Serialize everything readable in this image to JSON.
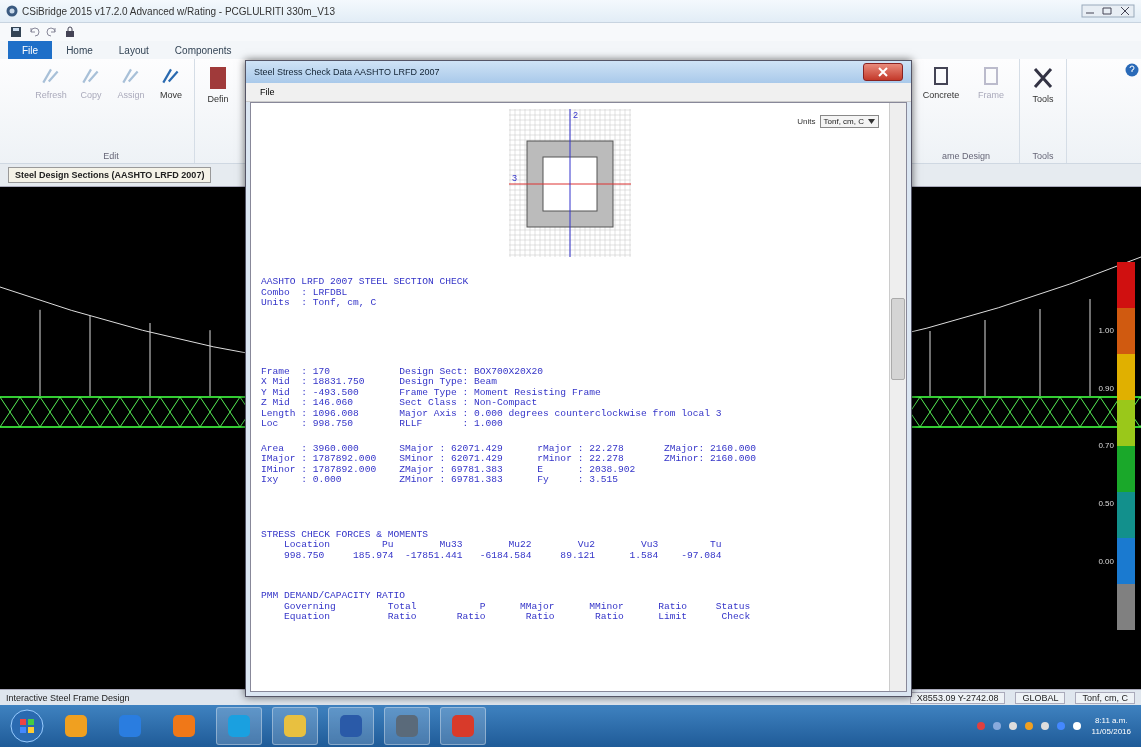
{
  "window": {
    "title": "CSiBridge 2015 v17.2.0 Advanced w/Rating  - PCGLULRITI 330m_V13"
  },
  "ribbon_tabs": [
    {
      "label": "File",
      "kind": "file"
    },
    {
      "label": "Home",
      "kind": "tab"
    },
    {
      "label": "Layout",
      "kind": "tab"
    },
    {
      "label": "Components",
      "kind": "tab"
    }
  ],
  "ribbon_left": {
    "buttons": [
      {
        "label": "Refresh",
        "disabled": true
      },
      {
        "label": "Copy",
        "disabled": true
      },
      {
        "label": "Assign",
        "disabled": true
      },
      {
        "label": "Move",
        "disabled": false
      }
    ],
    "group": "Edit",
    "cut_button": "Defin"
  },
  "ribbon_right": {
    "buttons": [
      {
        "label": "Concrete",
        "disabled": false
      },
      {
        "label": "Frame",
        "disabled": true
      }
    ],
    "group": "ame Design",
    "tools_button": "Tools",
    "tools_group": "Tools"
  },
  "panel_title": "Steel Design Sections (AASHTO LRFD 2007)",
  "legend": {
    "segments": [
      {
        "color": "#d01010"
      },
      {
        "color": "#d05a10"
      },
      {
        "color": "#e0b000"
      },
      {
        "color": "#9ac81a"
      },
      {
        "color": "#1aa82a"
      },
      {
        "color": "#12908c"
      },
      {
        "color": "#1a7ad0"
      },
      {
        "color": "#808080"
      }
    ],
    "labels": [
      "1.00",
      "0.90",
      "0.70",
      "0.50",
      "0.00"
    ]
  },
  "dialog": {
    "title": "Steel Stress Check Data  AASHTO LRFD 2007",
    "menu": [
      "File"
    ],
    "units_label": "Units",
    "units_value": "Tonf, cm, C",
    "section_axes": [
      "2",
      "3"
    ],
    "report": [
      [
        "AASHTO LRFD 2007 STEEL SECTION CHECK",
        "Combo  : LRFDBL",
        "Units  : Tonf, cm, C"
      ],
      [
        "Frame  : 170            Design Sect: BOX700X20X20",
        "X Mid  : 18831.750      Design Type: Beam",
        "Y Mid  : -493.500       Frame Type : Moment Resisting Frame",
        "Z Mid  : 146.060        Sect Class : Non-Compact",
        "Length : 1096.008       Major Axis : 0.000 degrees counterclockwise from local 3",
        "Loc    : 998.750        RLLF       : 1.000"
      ],
      [
        "Area   : 3960.000       SMajor : 62071.429      rMajor : 22.278       ZMajor: 2160.000",
        "IMajor : 1787892.000    SMinor : 62071.429      rMinor : 22.278       ZMinor: 2160.000",
        "IMinor : 1787892.000    ZMajor : 69781.383      E      : 2038.902",
        "Ixy    : 0.000          ZMinor : 69781.383      Fy     : 3.515"
      ],
      [
        "STRESS CHECK FORCES & MOMENTS",
        "    Location         Pu        Mu33        Mu22        Vu2        Vu3         Tu",
        "    998.750     185.974  -17851.441   -6184.584     89.121      1.584    -97.084"
      ],
      [
        "PMM DEMAND/CAPACITY RATIO",
        "    Governing         Total           P      MMajor      MMinor      Ratio     Status",
        "    Equation          Ratio       Ratio       Ratio       Ratio      Limit      Check"
      ]
    ]
  },
  "status_bar": {
    "left": "Interactive Steel Frame Design",
    "coords": "X8553.09  Y-2742.08",
    "system": "GLOBAL",
    "units": "Tonf, cm, C"
  },
  "taskbar": {
    "time": "8:11 a.m.",
    "date": "11/05/2016"
  }
}
